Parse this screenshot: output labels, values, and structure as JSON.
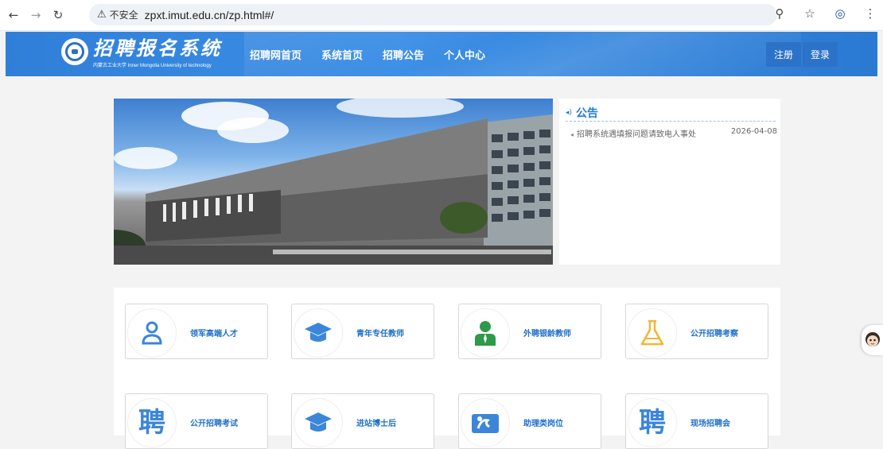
{
  "browser": {
    "security_label": "不安全",
    "url": "zpxt.imut.edu.cn/zp.html#/"
  },
  "site": {
    "title": "招聘报名系统",
    "subtitle": "内蒙古工业大学 Inner Mongolia University of technology",
    "nav": [
      "招聘网首页",
      "系统首页",
      "招聘公告",
      "个人中心"
    ],
    "register_label": "注册",
    "login_label": "登录"
  },
  "notice": {
    "title": "公告",
    "items": [
      {
        "text": "招聘系统遇填报问题请致电人事处",
        "date": "2026-04-08"
      }
    ]
  },
  "categories": [
    {
      "label": "领军高端人才",
      "icon": "person-icon"
    },
    {
      "label": "青年专任教师",
      "icon": "graduation-cap-icon"
    },
    {
      "label": "外聘银龄教师",
      "icon": "teacher-icon"
    },
    {
      "label": "公开招聘考察",
      "icon": "flask-icon"
    },
    {
      "label": "公开招聘考试",
      "icon": "pin-char-icon",
      "glyph": "聘"
    },
    {
      "label": "进站博士后",
      "icon": "graduation-cap-icon"
    },
    {
      "label": "助理类岗位",
      "icon": "assistant-icon"
    },
    {
      "label": "现场招聘会",
      "icon": "pin-char-icon",
      "glyph": "聘"
    }
  ],
  "colors": {
    "header_blue": "#2f7fd8",
    "accent": "#1f6fc9",
    "teacher_green": "#2e9a4a",
    "flask_yellow": "#f2b632"
  }
}
